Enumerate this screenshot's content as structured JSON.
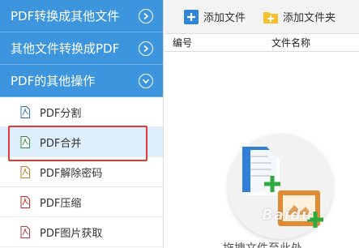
{
  "sidebar": {
    "sections": [
      {
        "label": "PDF转换成其他文件",
        "state": "collapsed"
      },
      {
        "label": "其他文件转换成PDF",
        "state": "collapsed"
      },
      {
        "label": "PDF的其他操作",
        "state": "expanded"
      }
    ],
    "items": [
      {
        "label": "PDF分割"
      },
      {
        "label": "PDF合并"
      },
      {
        "label": "PDF解除密码"
      },
      {
        "label": "PDF压缩"
      },
      {
        "label": "PDF图片获取"
      }
    ]
  },
  "toolbar": {
    "add_file": "添加文件",
    "add_folder": "添加文件夹"
  },
  "table": {
    "col_no": "编号",
    "col_name": "文件名称"
  },
  "empty_hint": "拖拽文件至此处",
  "watermark": "Baidu",
  "colors": {
    "section_bg": "#3c95dd",
    "selected_bg": "#ddeefc",
    "highlight": "#e53935"
  },
  "icons": {
    "section_collapsed": "chevron-right-icon",
    "section_expanded": "chevron-down-icon",
    "item": "pdf-file-icon",
    "add_file": "plus-icon",
    "add_folder": "folder-plus-icon"
  }
}
